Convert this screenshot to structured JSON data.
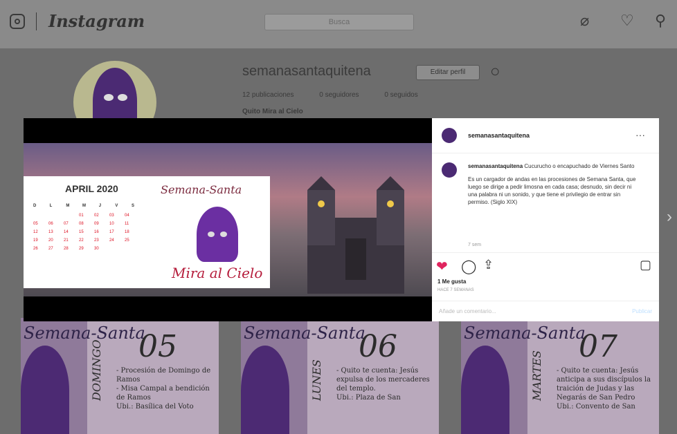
{
  "app": {
    "logo_text": "Instagram",
    "search_placeholder": "Busca"
  },
  "top_icons": [
    "compass-icon",
    "heart-icon",
    "user-icon"
  ],
  "profile": {
    "username": "semanasantaquitena",
    "edit_label": "Editar perfil",
    "stats": [
      "12 publicaciones",
      "0 seguidores",
      "0 seguidos"
    ],
    "full_name": "Quito Mira al Cielo"
  },
  "grid": [
    {
      "script": "Semana-Santa",
      "number": "05",
      "day": "DOMINGO",
      "desc": "- Procesión de Domingo de Ramos\n- Misa Campal a bendición de Ramos\nUbi.: Basílica del Voto"
    },
    {
      "script": "Semana-Santa",
      "number": "06",
      "day": "LUNES",
      "desc": "- Quito te cuenta: Jesús expulsa de los mercaderes del templo.\nUbi.: Plaza de San"
    },
    {
      "script": "Semana-Santa",
      "number": "07",
      "day": "MARTES",
      "desc": "- Quito te cuenta: Jesús anticipa a sus discípulos la traición de Judas y las Negarás de San Pedro\nUbi.: Convento de San"
    }
  ],
  "modal": {
    "calendar": {
      "title": "APRIL 2020",
      "weekdays": [
        "D",
        "L",
        "M",
        "M",
        "J",
        "V",
        "S"
      ],
      "rows": [
        [
          "",
          "",
          "",
          "01",
          "02",
          "03",
          "04"
        ],
        [
          "05",
          "06",
          "07",
          "08",
          "09",
          "10",
          "11"
        ],
        [
          "12",
          "13",
          "14",
          "15",
          "16",
          "17",
          "18"
        ],
        [
          "19",
          "20",
          "21",
          "22",
          "23",
          "24",
          "25"
        ],
        [
          "26",
          "27",
          "28",
          "29",
          "30",
          "",
          ""
        ]
      ]
    },
    "semana_text": "Semana-Santa",
    "mira_text": "Mira al Cielo",
    "post_user": "semanasantaquitena",
    "caption_user": "semanasantaquitena",
    "caption_first": "Cucurucho o encapuchado de Viernes Santo",
    "caption_body": "Es un cargador de andas en las procesiones de Semana Santa, que luego se dirige a pedir limosna en cada casa; desnudo, sin decir ni una palabra ni un sonido, y que tiene el privilegio de entrar sin permiso. (Siglo XIX)",
    "time_ago": "7 sem",
    "likes": "1 Me gusta",
    "date": "HACE 7 SEMANAS",
    "add_comment_placeholder": "Añade un comentario...",
    "publish_label": "Publicar"
  }
}
